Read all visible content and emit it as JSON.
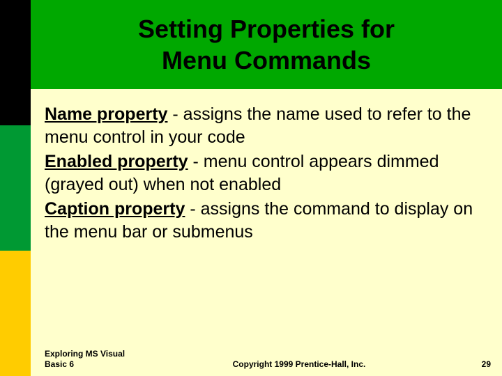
{
  "colors": {
    "slide_bg": "#ffffcc",
    "title_bg": "#00a800",
    "sidebar_stripe1": "#000000",
    "sidebar_stripe2": "#009933",
    "sidebar_stripe3": "#ffcc00"
  },
  "title": {
    "line1": "Setting Properties for",
    "line2": "Menu Commands"
  },
  "body": {
    "items": [
      {
        "head": "Name property",
        "rest": " - assigns the name used to refer to the menu control in your code"
      },
      {
        "head": "Enabled property",
        "rest": " - menu control appears dimmed (grayed out) when not enabled"
      },
      {
        "head": "Caption property",
        "rest": " - assigns the command to display on the menu bar or submenus"
      }
    ]
  },
  "footer": {
    "left": "Exploring MS Visual Basic 6",
    "center": "Copyright 1999 Prentice-Hall, Inc.",
    "right": "29"
  }
}
